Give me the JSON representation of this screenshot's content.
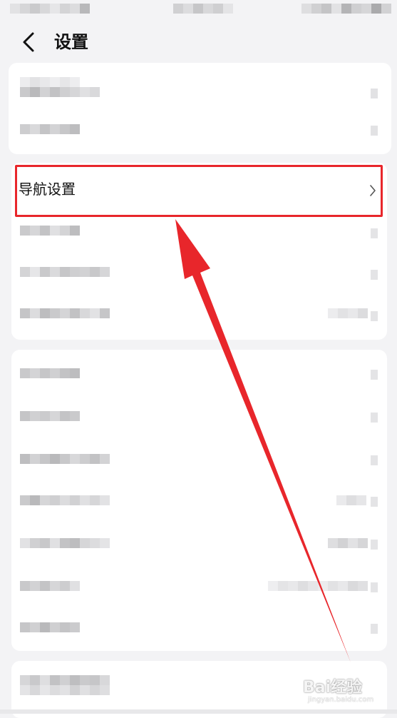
{
  "header": {
    "back_icon": "chevron-left-icon",
    "title": "设置"
  },
  "highlighted_row": {
    "label": "导航设置",
    "chevron_icon": "chevron-right-icon"
  },
  "annotation": {
    "highlight_color": "#e8262b",
    "arrow_color": "#e8262b"
  },
  "watermark": {
    "text": "Bai经验",
    "sub": "jingyan.baidu.com"
  }
}
